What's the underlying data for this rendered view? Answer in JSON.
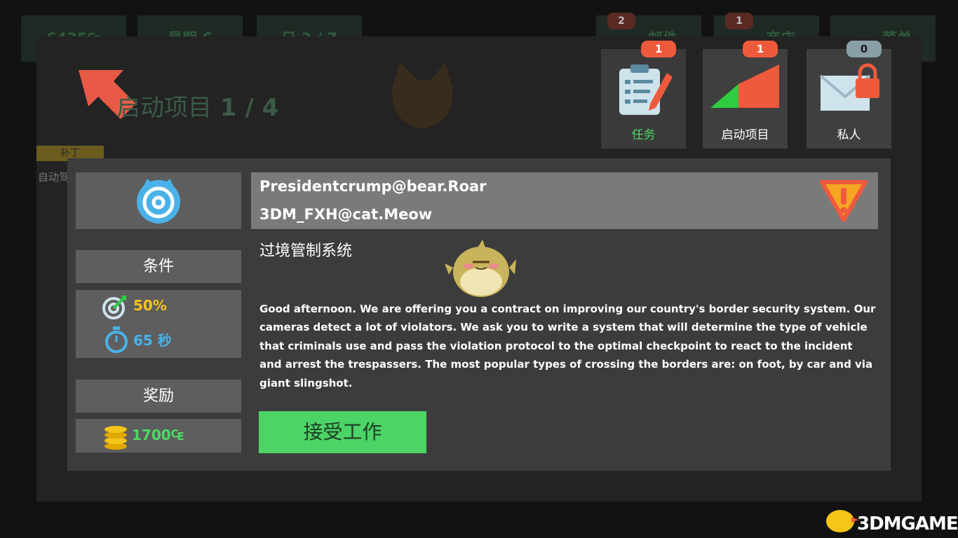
{
  "hud": {
    "money": "6425",
    "money_symbol": "₠",
    "weekday": "星期 6",
    "day": "日 3 / 7",
    "mail_label": "邮件",
    "mail_badge": "2",
    "shop_label": "商店",
    "shop_badge": "1",
    "menu_label": "菜单"
  },
  "background": {
    "startup_title": "启动项目",
    "startup_count": "1 / 4",
    "patch_label": "补丁",
    "auto_label": "自动驾"
  },
  "tabs": [
    {
      "label": "任务",
      "badge": "1",
      "icon": "clipboard-pencil-icon"
    },
    {
      "label": "启动项目",
      "badge": "1",
      "icon": "rising-chart-icon"
    },
    {
      "label": "私人",
      "badge": "0",
      "icon": "locked-envelope-icon"
    }
  ],
  "mail": {
    "from": "Presidentcrump@bear.Roar",
    "to": "3DM_FXH@cat.Meow",
    "subject": "过境管制系统",
    "body": "Good afternoon. We are offering you a contract on improving our country's border security system. Our cameras detect a lot of violators. We ask you to write a system that will determine the type of vehicle that criminals use and pass the violation protocol to the optimal checkpoint to react to the incident and arrest the trespassers. The most popular types of crossing the borders are: on foot, by car and via giant slingshot.",
    "accept_label": "接受工作",
    "warning_icon": "warning-triangle-icon",
    "sender_icon": "cat-at-sign-icon"
  },
  "conditions": {
    "title": "条件",
    "accuracy": "50%",
    "time": "65 秒"
  },
  "reward": {
    "title": "奖励",
    "amount": "1700",
    "currency": "₠"
  },
  "watermark": "3DMGAME",
  "colors": {
    "green": "#4cd964",
    "accent_red": "#f05a3c",
    "gold": "#f5c518",
    "blue": "#4aa8d8"
  }
}
